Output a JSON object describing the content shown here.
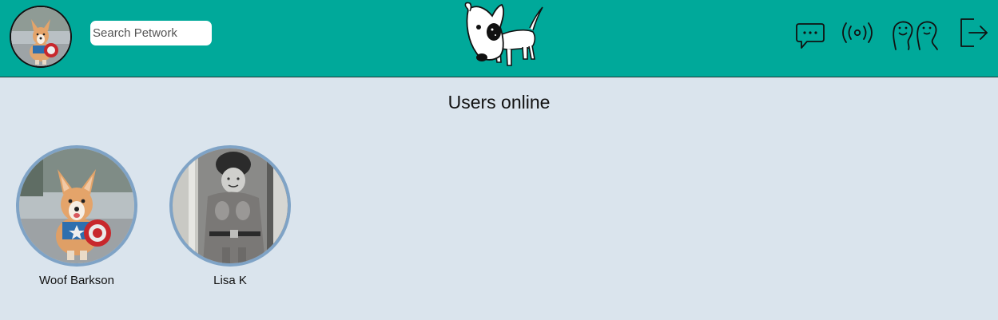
{
  "header": {
    "search": {
      "placeholder": "Search Petwork",
      "value": ""
    },
    "nav_icons": [
      "chat-icon",
      "broadcast-icon",
      "friends-icon",
      "logout-icon"
    ],
    "colors": {
      "header_bg": "#00a99a",
      "page_bg": "#dae4ed",
      "avatar_ring": "#7fa3c6"
    }
  },
  "main": {
    "title": "Users online",
    "users": [
      {
        "name": "Woof Barkson"
      },
      {
        "name": "Lisa K"
      }
    ]
  }
}
